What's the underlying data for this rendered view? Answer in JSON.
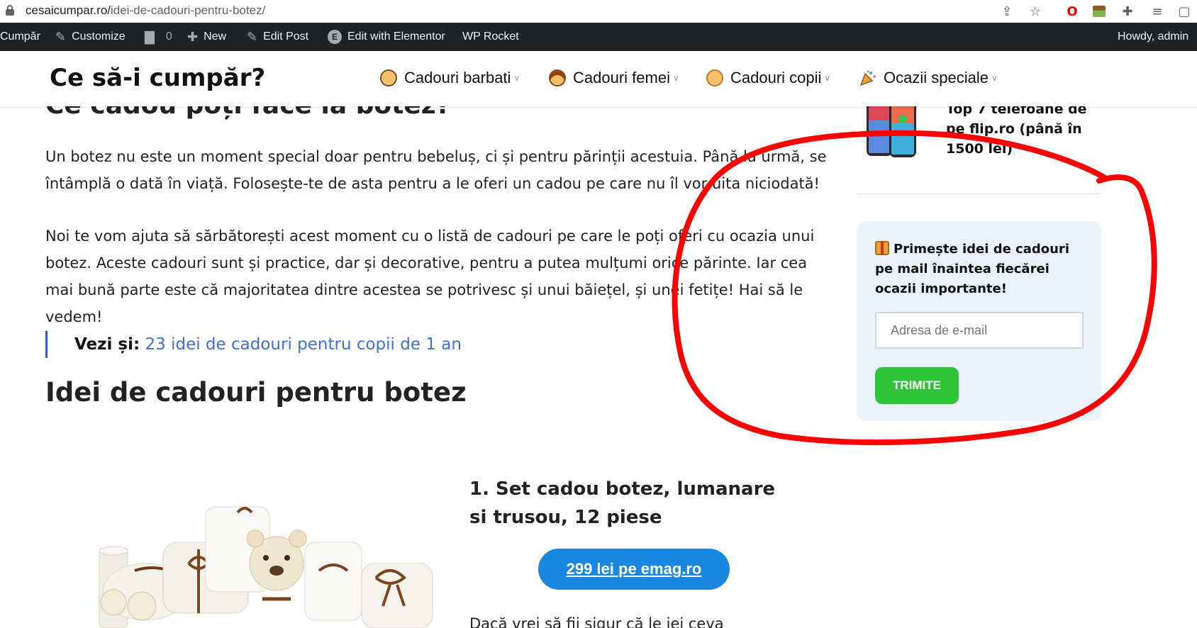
{
  "browser": {
    "url_domain": "cesaicumpar.ro/",
    "url_path": "idei-de-cadouri-pentru-botez/",
    "icons": [
      "lock-icon",
      "share-icon",
      "star-icon",
      "opera-icon",
      "extension-grass-icon",
      "puzzle-icon",
      "media-icon",
      "window-icon"
    ]
  },
  "adminbar": {
    "site": "Cumpăr",
    "customize": "Customize",
    "comments_count": "0",
    "new": "New",
    "edit_post": "Edit Post",
    "edit_elementor": "Edit with Elementor",
    "wp_rocket": "WP Rocket",
    "howdy": "Howdy, admin"
  },
  "header": {
    "logo": "Ce să-i cumpăr?",
    "nav": [
      {
        "label": "Cadouri barbati",
        "icon": "man-emoji-icon"
      },
      {
        "label": "Cadouri femei",
        "icon": "woman-emoji-icon"
      },
      {
        "label": "Cadouri copii",
        "icon": "child-emoji-icon"
      },
      {
        "label": "Ocazii speciale",
        "icon": "party-popper-icon"
      }
    ]
  },
  "article": {
    "heading_top": "Ce cadou poți face la botez?",
    "p1": "Un botez nu este un moment special doar pentru bebeluș, ci și pentru părinții acestuia. Până la urmă, se întâmplă o dată în viață. Folosește-te de asta pentru a le oferi un cadou pe care nu îl vor uita niciodată!",
    "p2": "Noi te vom ajuta să sărbătorești acest moment cu o listă de cadouri pe care le poți oferi cu ocazia unui botez. Aceste cadouri sunt și practice, dar și decorative, pentru a putea mulțumi orice părinte. Iar cea mai bună parte este că majoritatea dintre acestea se potrivesc și unui băiețel, și unei fetițe! Hai să le vedem!",
    "see_also_label": "Vezi și:",
    "see_also_link": "23 idei de cadouri pentru copii de 1 an",
    "heading_main": "Idei de cadouri pentru botez",
    "product_title": "1. Set cadou botez, lumanare si trusou, 12 piese",
    "price_button": "299 lei pe emag.ro",
    "cut_text": "Dacă vrei să fii sigur că le iei ceva"
  },
  "sidebar": {
    "post_title": "Top 7 telefoane de pe flip.ro (până în 1500 lei)",
    "newsletter_title": "Primește idei de cadouri pe mail înaintea fiecărei ocazii importante!",
    "email_placeholder": "Adresa de e-mail",
    "submit": "TRIMITE"
  },
  "colors": {
    "admin_bar": "#1d2327",
    "link": "#3f6fd9",
    "price_button": "#1a88e0",
    "submit_button": "#2fc43a",
    "newsletter_bg": "#eaf3fd",
    "annotation": "#ff0000"
  }
}
